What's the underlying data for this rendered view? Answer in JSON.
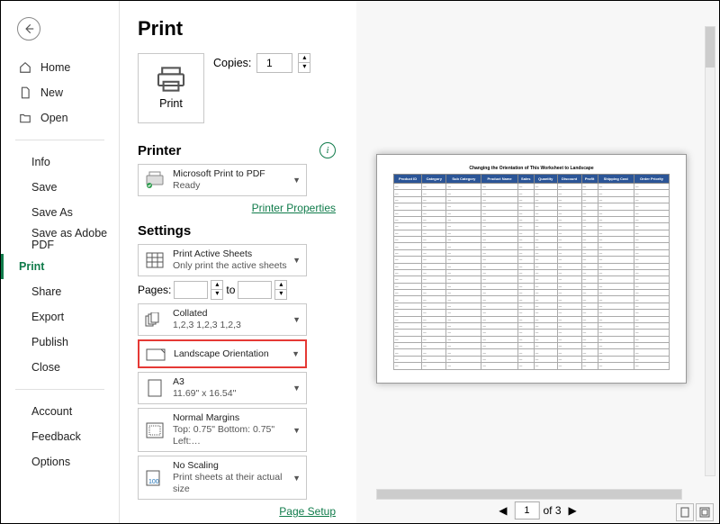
{
  "page_title": "Print",
  "back_label": "Back",
  "sidebar": {
    "primary": [
      {
        "label": "Home",
        "icon": "home-icon"
      },
      {
        "label": "New",
        "icon": "new-icon"
      },
      {
        "label": "Open",
        "icon": "open-icon"
      }
    ],
    "file": [
      {
        "label": "Info"
      },
      {
        "label": "Save"
      },
      {
        "label": "Save As"
      },
      {
        "label": "Save as Adobe PDF"
      },
      {
        "label": "Print",
        "active": true
      },
      {
        "label": "Share"
      },
      {
        "label": "Export"
      },
      {
        "label": "Publish"
      },
      {
        "label": "Close"
      }
    ],
    "bottom": [
      {
        "label": "Account"
      },
      {
        "label": "Feedback"
      },
      {
        "label": "Options"
      }
    ]
  },
  "print_button_label": "Print",
  "copies": {
    "label": "Copies:",
    "value": "1"
  },
  "printer": {
    "section_label": "Printer",
    "name": "Microsoft Print to PDF",
    "status": "Ready",
    "props_link": "Printer Properties"
  },
  "settings": {
    "section_label": "Settings",
    "print_what": {
      "title": "Print Active Sheets",
      "sub": "Only print the active sheets"
    },
    "pages": {
      "label": "Pages:",
      "to_label": "to",
      "from": "",
      "to": ""
    },
    "collated": {
      "title": "Collated",
      "sub": "1,2,3   1,2,3   1,2,3"
    },
    "orientation": {
      "title": "Landscape Orientation"
    },
    "paper": {
      "title": "A3",
      "sub": "11.69\" x 16.54\""
    },
    "margins": {
      "title": "Normal Margins",
      "sub": "Top: 0.75\" Bottom: 0.75\" Left:…"
    },
    "scaling": {
      "title": "No Scaling",
      "sub": "Print sheets at their actual size"
    },
    "page_setup_link": "Page Setup"
  },
  "preview": {
    "document_title": "Changing the Orientation of This Worksheet to Landscape",
    "headers": [
      "Product ID",
      "Category",
      "Sub Category",
      "Product Name",
      "Sales",
      "Quantity",
      "Discount",
      "Profit",
      "Shipping Cost",
      "Order Priority"
    ],
    "page_current": "1",
    "page_total": "of 3"
  }
}
